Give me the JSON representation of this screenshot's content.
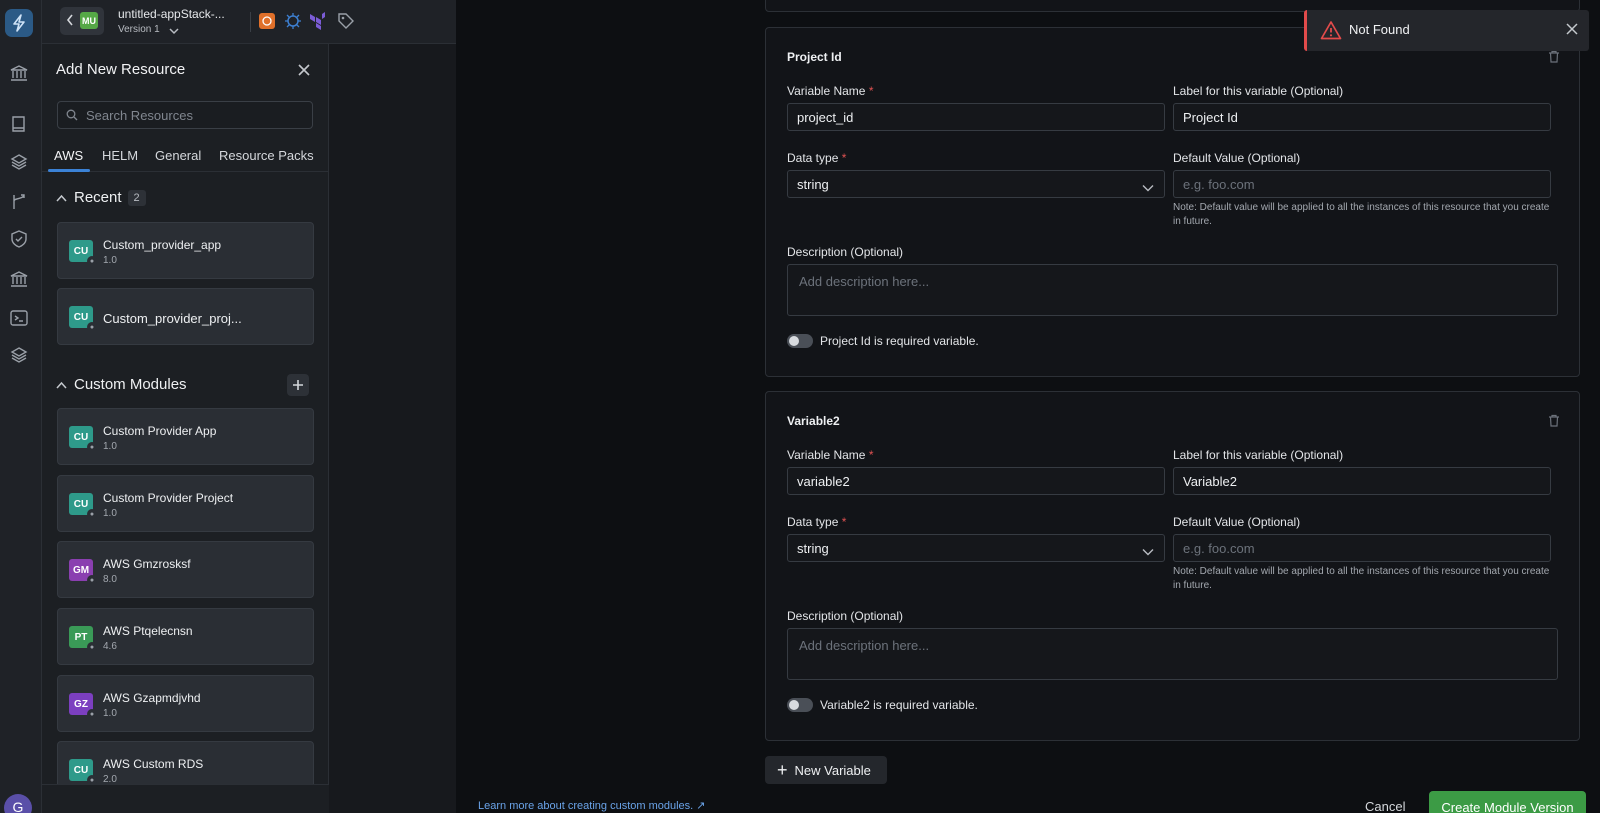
{
  "topbar": {
    "badge": "MU",
    "app_title": "untitled-appStack-...",
    "version": "Version 1"
  },
  "panel": {
    "title": "Add New Resource",
    "search_placeholder": "Search Resources",
    "tabs": [
      "AWS",
      "HELM",
      "General",
      "Resource Packs"
    ],
    "recent": {
      "label": "Recent",
      "count": "2",
      "items": [
        {
          "badge": "CU",
          "color": "#2e9a8a",
          "name": "Custom_provider_app",
          "version": "1.0"
        },
        {
          "badge": "CU",
          "color": "#2e9a8a",
          "name": "Custom_provider_proj...",
          "version": ""
        }
      ]
    },
    "custom_modules": {
      "label": "Custom Modules",
      "items": [
        {
          "badge": "CU",
          "color": "#2e9a8a",
          "name": "Custom Provider App",
          "version": "1.0"
        },
        {
          "badge": "CU",
          "color": "#2e9a8a",
          "name": "Custom Provider Project",
          "version": "1.0"
        },
        {
          "badge": "GM",
          "color": "#8a3fb0",
          "name": "AWS Gmzrosksf",
          "version": "8.0"
        },
        {
          "badge": "PT",
          "color": "#3a9a57",
          "name": "AWS Ptqelecnsn",
          "version": "4.6"
        },
        {
          "badge": "GZ",
          "color": "#7c3fc0",
          "name": "AWS Gzapmdjvhd",
          "version": "1.0"
        },
        {
          "badge": "CU",
          "color": "#2e9a8a",
          "name": "AWS Custom RDS",
          "version": "2.0"
        }
      ]
    }
  },
  "rail": {
    "avatar": "G"
  },
  "variables": [
    {
      "title": "Project Id",
      "name_label": "Variable Name",
      "name_value": "project_id",
      "label_label": "Label for this variable (Optional)",
      "label_value": "Project Id",
      "type_label": "Data type",
      "type_value": "string",
      "default_label": "Default Value (Optional)",
      "default_placeholder": "e.g. foo.com",
      "note": "Note: Default value will be applied to all the instances of this resource that you create in future.",
      "desc_label": "Description (Optional)",
      "desc_placeholder": "Add description here...",
      "required_label": "Project Id is required variable."
    },
    {
      "title": "Variable2",
      "name_label": "Variable Name",
      "name_value": "variable2",
      "label_label": "Label for this variable (Optional)",
      "label_value": "Variable2",
      "type_label": "Data type",
      "type_value": "string",
      "default_label": "Default Value (Optional)",
      "default_placeholder": "e.g. foo.com",
      "note": "Note: Default value will be applied to all the instances of this resource that you create in future.",
      "desc_label": "Description (Optional)",
      "desc_placeholder": "Add description here...",
      "required_label": "Variable2 is required variable."
    }
  ],
  "footer": {
    "new_variable": "New Variable",
    "learn_link": "Learn more about creating custom modules.",
    "cancel": "Cancel",
    "create": "Create Module Version"
  },
  "toast": {
    "text": "Not Found"
  },
  "colors": {
    "accent": "#3b82d6",
    "success": "#3c9b45",
    "danger": "#e24b4b"
  }
}
